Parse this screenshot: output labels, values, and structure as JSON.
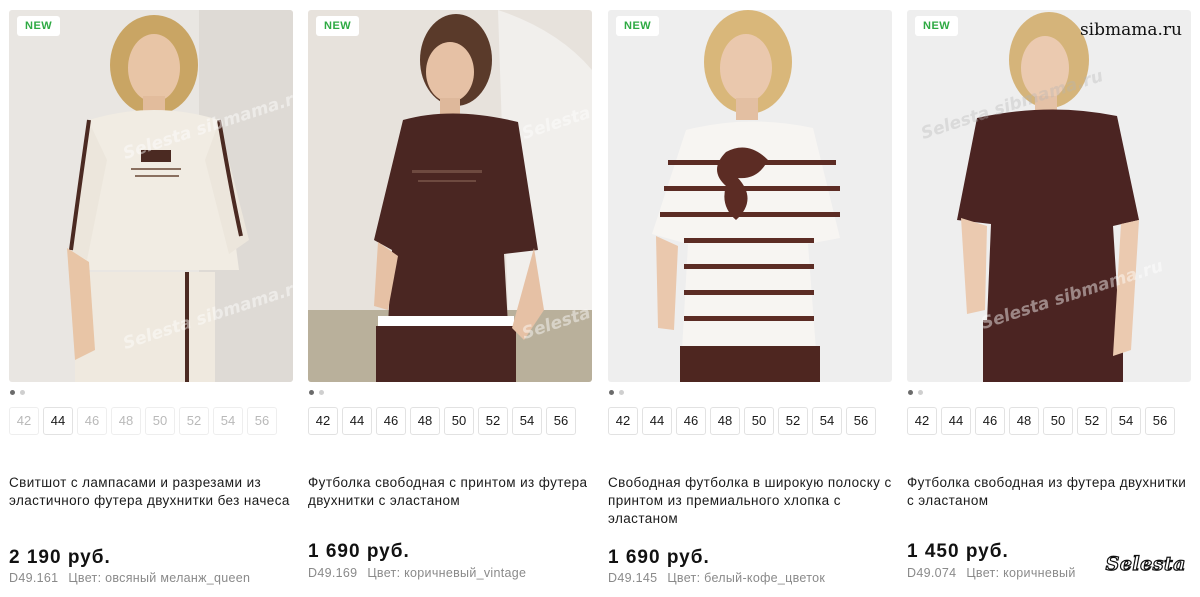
{
  "products": [
    {
      "badge": "NEW",
      "image": {
        "desc": "woman-in-oatmeal-sweatshirt",
        "bg": "#e9e6e2",
        "garment": "#f1ece3",
        "accent": "#4b2a22",
        "pants": "#efe9df"
      },
      "sizes": [
        {
          "label": "42",
          "available": false
        },
        {
          "label": "44",
          "available": true
        },
        {
          "label": "46",
          "available": false
        },
        {
          "label": "48",
          "available": false
        },
        {
          "label": "50",
          "available": false
        },
        {
          "label": "52",
          "available": false
        },
        {
          "label": "54",
          "available": false
        },
        {
          "label": "56",
          "available": false
        }
      ],
      "title": "Свитшот с лампасами и разрезами из эластичного футера двухнитки без начеса",
      "price": "2 190 руб.",
      "sku": "D49.161",
      "color": "Цвет: овсяный меланж_queen"
    },
    {
      "badge": "NEW",
      "image": {
        "desc": "woman-in-brown-tshirt",
        "bg": "#e7e2dc",
        "garment": "#4a2622",
        "accent": "#ffffff",
        "pants": "#4a2622"
      },
      "sizes": [
        {
          "label": "42",
          "available": true
        },
        {
          "label": "44",
          "available": true
        },
        {
          "label": "46",
          "available": true
        },
        {
          "label": "48",
          "available": true
        },
        {
          "label": "50",
          "available": true
        },
        {
          "label": "52",
          "available": true
        },
        {
          "label": "54",
          "available": true
        },
        {
          "label": "56",
          "available": true
        }
      ],
      "title": "Футболка свободная с принтом из футера двухнитки с эластаном",
      "price": "1 690 руб.",
      "sku": "D49.169",
      "color": "Цвет: коричневый_vintage"
    },
    {
      "badge": "NEW",
      "image": {
        "desc": "woman-in-striped-tshirt",
        "bg": "#eeeeee",
        "garment": "#f7f5f2",
        "accent": "#5c2c24",
        "pants": "#4e2620"
      },
      "sizes": [
        {
          "label": "42",
          "available": true
        },
        {
          "label": "44",
          "available": true
        },
        {
          "label": "46",
          "available": true
        },
        {
          "label": "48",
          "available": true
        },
        {
          "label": "50",
          "available": true
        },
        {
          "label": "52",
          "available": true
        },
        {
          "label": "54",
          "available": true
        },
        {
          "label": "56",
          "available": true
        }
      ],
      "title": "Свободная футболка в широкую полоску с принтом из премиального хлопка с эластаном",
      "price": "1 690 руб.",
      "sku": "D49.145",
      "color": "Цвет: белый-кофе_цветок"
    },
    {
      "badge": "NEW",
      "image": {
        "desc": "woman-in-brown-tshirt-plain",
        "bg": "#eeeeee",
        "garment": "#4b2422",
        "accent": "#4b2422",
        "pants": "#4b2422"
      },
      "sizes": [
        {
          "label": "42",
          "available": true
        },
        {
          "label": "44",
          "available": true
        },
        {
          "label": "46",
          "available": true
        },
        {
          "label": "48",
          "available": true
        },
        {
          "label": "50",
          "available": true
        },
        {
          "label": "52",
          "available": true
        },
        {
          "label": "54",
          "available": true
        },
        {
          "label": "56",
          "available": true
        }
      ],
      "title": "Футболка свободная из футера двухнитки с эластаном",
      "price": "1 450 руб.",
      "sku": "D49.074",
      "color": "Цвет: коричневый"
    }
  ],
  "watermarks": {
    "site": "sibmama.ru",
    "brand": "Selesta",
    "diagonal": "Selesta sibmama.ru"
  },
  "colors": {
    "badge_text": "#2eaa43",
    "price": "#111111",
    "meta": "#8a8a8a"
  }
}
